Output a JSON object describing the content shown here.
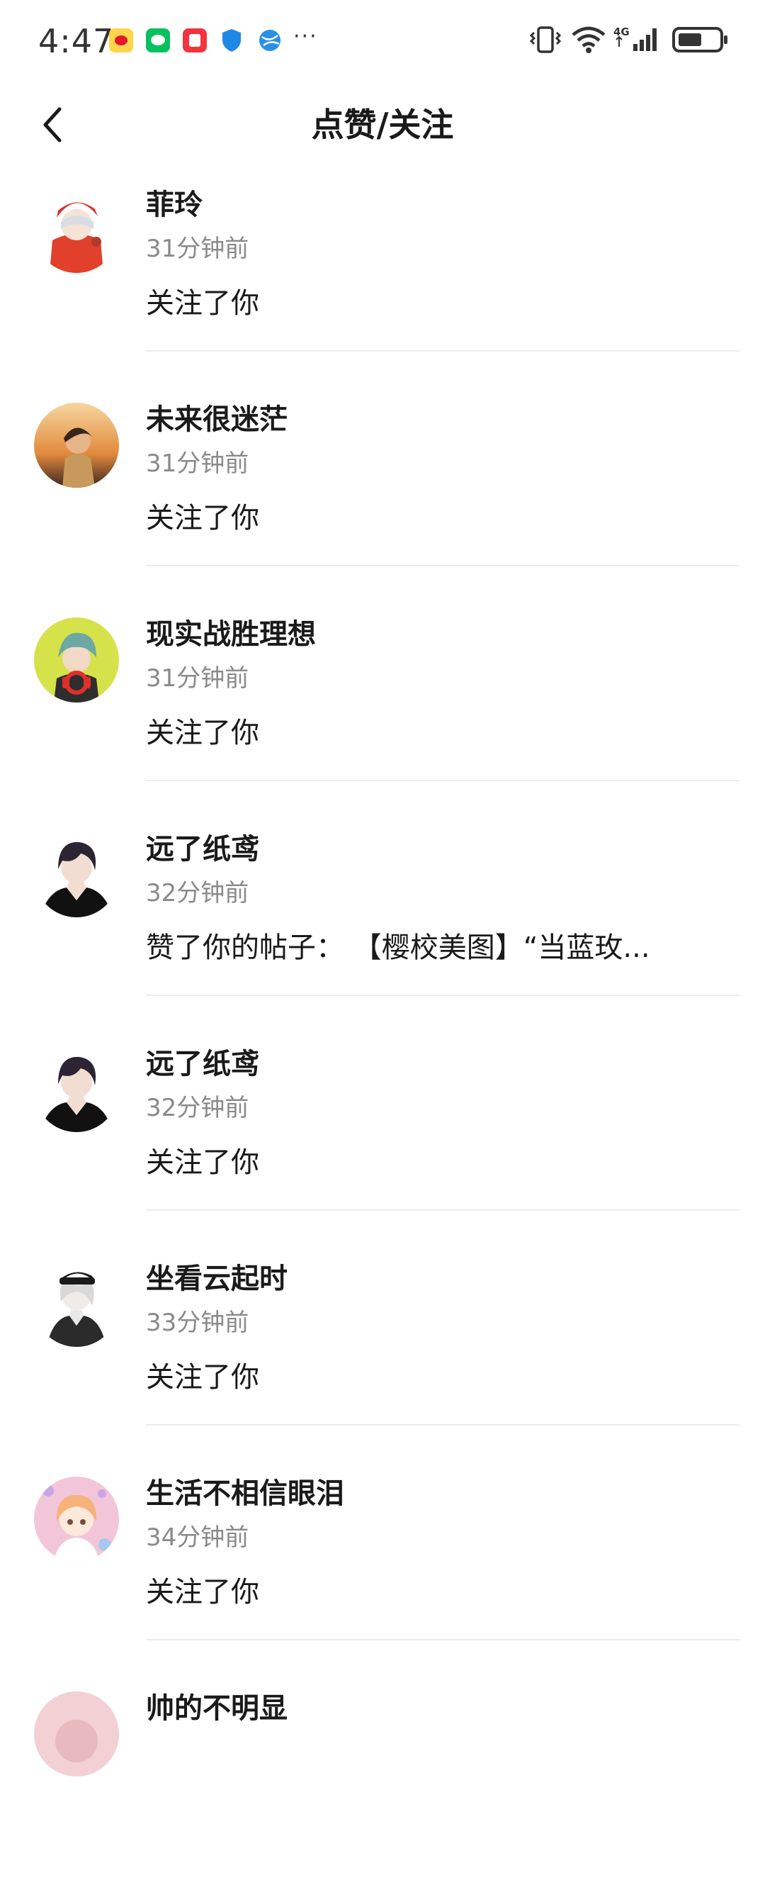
{
  "status_bar": {
    "time": "4:47",
    "more": "···",
    "network": "4G"
  },
  "header": {
    "title": "点赞/关注"
  },
  "notifications": [
    {
      "name": "菲玲",
      "time": "31分钟前",
      "action": "关注了你",
      "avatar_color": "#e0402c"
    },
    {
      "name": "未来很迷茫",
      "time": "31分钟前",
      "action": "关注了你",
      "avatar_color": "#d98a3a"
    },
    {
      "name": "现实战胜理想",
      "time": "31分钟前",
      "action": "关注了你",
      "avatar_color": "#d6e24a"
    },
    {
      "name": "远了纸鸢",
      "time": "32分钟前",
      "action": "赞了你的帖子： 【樱校美图】“当蓝玫...",
      "avatar_color": "#2a2a2e"
    },
    {
      "name": "远了纸鸢",
      "time": "32分钟前",
      "action": "关注了你",
      "avatar_color": "#2a2a2e"
    },
    {
      "name": "坐看云起时",
      "time": "33分钟前",
      "action": "关注了你",
      "avatar_color": "#3a3a3a"
    },
    {
      "name": "生活不相信眼泪",
      "time": "34分钟前",
      "action": "关注了你",
      "avatar_color": "#f2c6d8"
    },
    {
      "name": "帅的不明显",
      "time": "",
      "action": "",
      "avatar_color": "#f3d0d4"
    }
  ]
}
